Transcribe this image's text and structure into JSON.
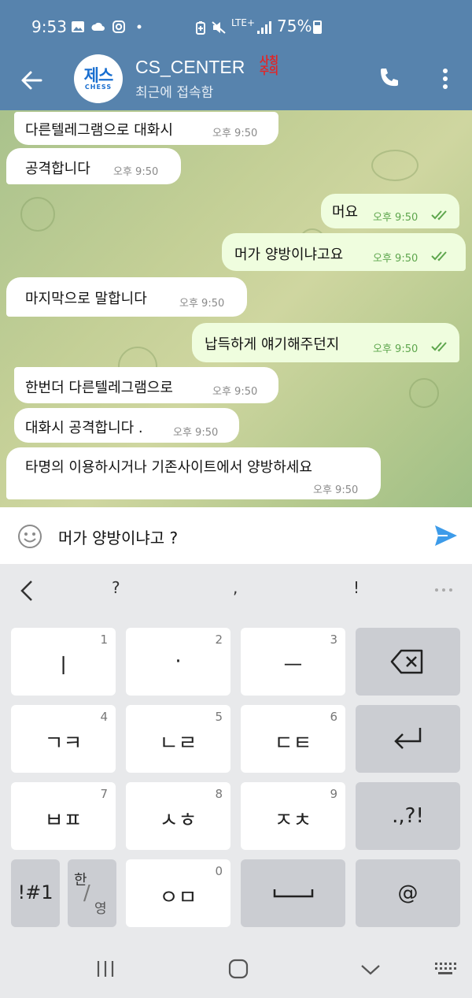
{
  "status_bar": {
    "time": "9:53",
    "network": "LTE+",
    "battery": "75%"
  },
  "header": {
    "chat_name": "CS_CENTER",
    "name_tag": "사칭주의",
    "status": "최근에 접속함",
    "avatar_text": "제스",
    "avatar_sub": "CHESS"
  },
  "messages": [
    {
      "dir": "in",
      "text": "다른텔레그램으로 대화시",
      "time": "오후 9:50"
    },
    {
      "dir": "in",
      "text": "공격합니다",
      "time": "오후 9:50"
    },
    {
      "dir": "out",
      "text": "머요",
      "time": "오후 9:50"
    },
    {
      "dir": "out",
      "text": "머가 양방이냐고요",
      "time": "오후 9:50"
    },
    {
      "dir": "in",
      "text": "마지막으로 말합니다",
      "time": "오후 9:50"
    },
    {
      "dir": "out",
      "text": "납득하게 얘기해주던지",
      "time": "오후 9:50"
    },
    {
      "dir": "in",
      "text": "한번더 다른텔레그램으로",
      "time": "오후 9:50"
    },
    {
      "dir": "in",
      "text": "대화시 공격합니다 .",
      "time": "오후 9:50"
    },
    {
      "dir": "in",
      "text": "타명의 이용하시거나 기존사이트에서 양방하세요",
      "time": "오후 9:50"
    }
  ],
  "input": {
    "value": "머가 양방이냐고 ?"
  },
  "keyboard": {
    "suggestions": [
      "?",
      ",",
      "!"
    ],
    "keys": [
      {
        "num": "1",
        "label": "ㅣ"
      },
      {
        "num": "2",
        "label": "·"
      },
      {
        "num": "3",
        "label": "ㅡ"
      },
      {
        "num": "4",
        "label": "ㄱㅋ"
      },
      {
        "num": "5",
        "label": "ㄴㄹ"
      },
      {
        "num": "6",
        "label": "ㄷㅌ"
      },
      {
        "num": "7",
        "label": "ㅂㅍ"
      },
      {
        "num": "8",
        "label": "ㅅㅎ"
      },
      {
        "num": "9",
        "label": "ㅈㅊ"
      },
      {
        "num": "0",
        "label": "ㅇㅁ"
      }
    ],
    "punct_label": ".,?!",
    "symbols_label": "!#1",
    "lang_top": "한",
    "lang_bottom": "영",
    "at_label": "@"
  },
  "colors": {
    "header_blue": "#5783ad",
    "outgoing_bubble": "#effdde",
    "incoming_bubble": "#ffffff",
    "send_blue": "#3d9be9"
  }
}
